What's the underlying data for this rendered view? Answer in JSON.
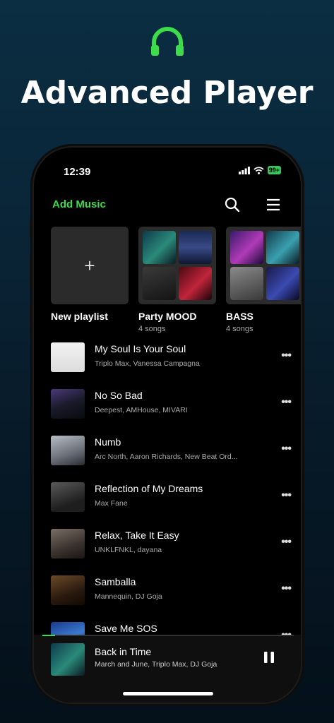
{
  "promo": {
    "title": "Advanced Player"
  },
  "status": {
    "time": "12:39",
    "battery": "99+"
  },
  "toolbar": {
    "add_music": "Add Music"
  },
  "playlists": [
    {
      "name": "New playlist",
      "count": ""
    },
    {
      "name": "Party MOOD",
      "count": "4 songs"
    },
    {
      "name": "BASS",
      "count": "4 songs"
    }
  ],
  "songs": [
    {
      "title": "My Soul Is Your Soul",
      "artist": "Triplo Max, Vanessa Campagna"
    },
    {
      "title": "No So Bad",
      "artist": "Deepest, AMHouse, MIVARI"
    },
    {
      "title": "Numb",
      "artist": "Arc North, Aaron Richards, New Beat Ord..."
    },
    {
      "title": "Reflection of My Dreams",
      "artist": "Max Fane"
    },
    {
      "title": "Relax, Take It Easy",
      "artist": "UNKLFNKL, dayana"
    },
    {
      "title": "Samballa",
      "artist": "Mannequin, DJ Goja"
    },
    {
      "title": "Save Me SOS",
      "artist": ""
    }
  ],
  "now_playing": {
    "title": "Back in Time",
    "artist": "March and June, Triplo Max, DJ Goja",
    "progress": 0.05
  },
  "colors": {
    "accent": "#3ddc4a",
    "background": "#000000",
    "battery": "#34c759"
  }
}
